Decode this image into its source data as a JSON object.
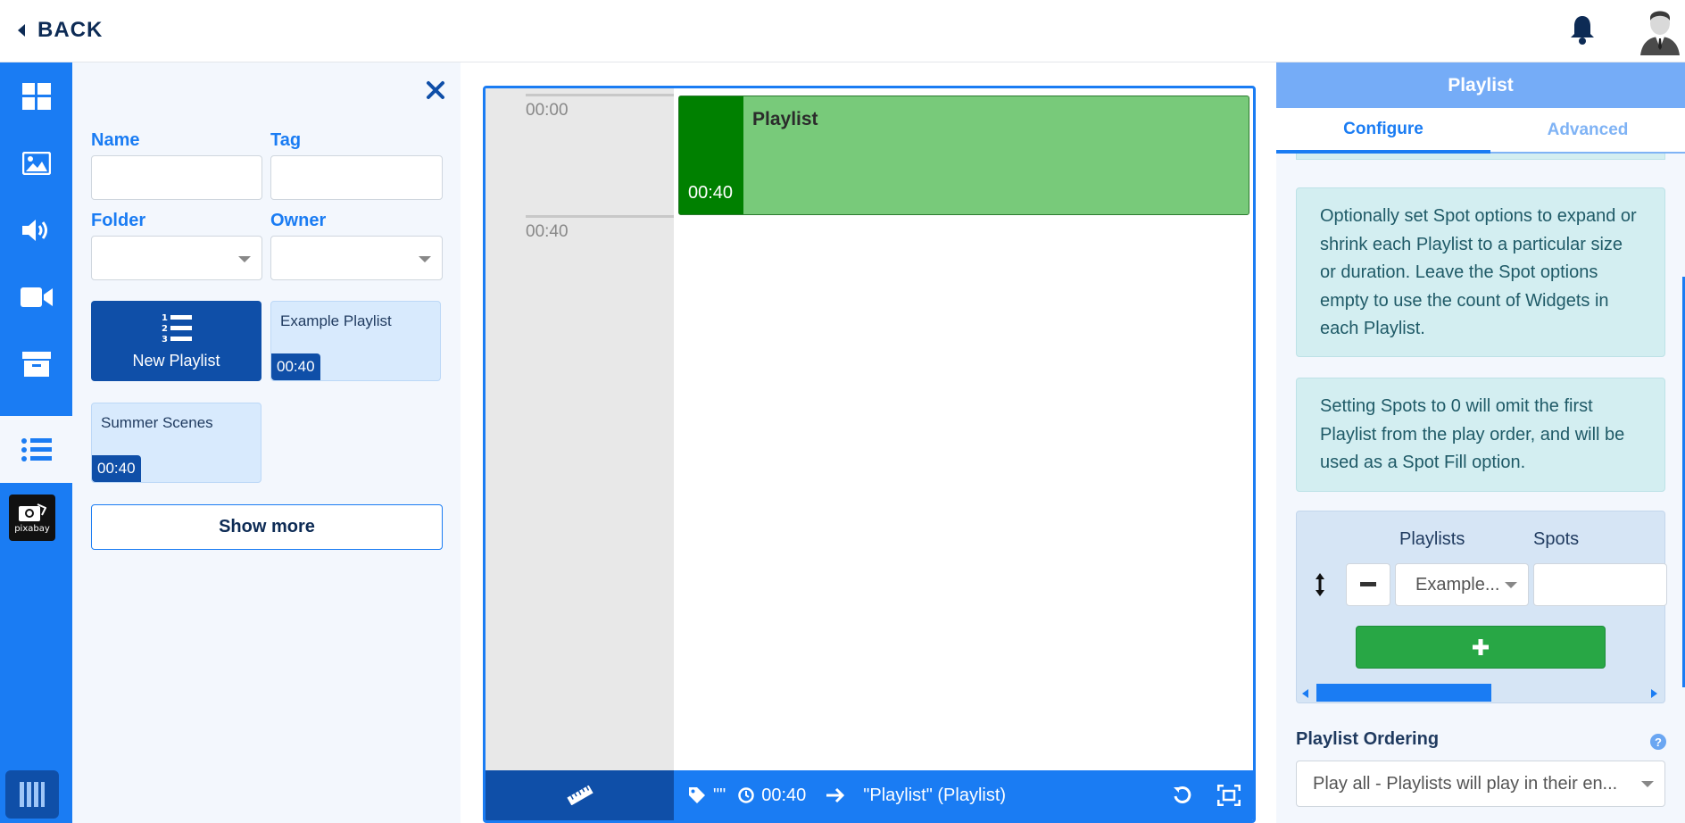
{
  "topbar": {
    "back_label": "BACK"
  },
  "nav": {
    "items": [
      "dashboard-icon",
      "image-icon",
      "audio-icon",
      "video-icon",
      "archive-icon",
      "playlist-icon",
      "pixabay-icon"
    ],
    "pixabay_label": "pixabay",
    "active": "playlist-icon"
  },
  "library": {
    "name_label": "Name",
    "tag_label": "Tag",
    "folder_label": "Folder",
    "owner_label": "Owner",
    "name_value": "",
    "tag_value": "",
    "folder_value": "",
    "owner_value": "",
    "new_playlist_label": "New Playlist",
    "cards": [
      {
        "title": "Example Playlist",
        "duration": "00:40"
      },
      {
        "title": "Summer Scenes",
        "duration": "00:40"
      }
    ],
    "show_more_label": "Show more"
  },
  "timeline": {
    "ticks": [
      "00:00",
      "00:40"
    ],
    "block": {
      "title": "Playlist",
      "duration": "00:40",
      "color": "#78ca7a",
      "side_color": "#008000"
    },
    "footer": {
      "tag_text": "\"\"",
      "duration": "00:40",
      "target": "\"Playlist\" (Playlist)"
    }
  },
  "panel": {
    "header": "Playlist",
    "tabs": {
      "configure": "Configure",
      "advanced": "Advanced",
      "active": "configure"
    },
    "alert1": "Optionally set Spot options to expand or shrink each Playlist to a particular size or duration. Leave the Spot options empty to use the count of Widgets in each Playlist.",
    "alert2": "Setting Spots to 0 will omit the first Playlist from the play order, and will be used as a Spot Fill option.",
    "spots": {
      "col_playlists": "Playlists",
      "col_spots": "Spots",
      "row_playlist": "Example...",
      "row_spots": ""
    },
    "ordering_label": "Playlist Ordering",
    "help": "?",
    "ordering_value": "Play all - Playlists will play in their en..."
  },
  "colors": {
    "primary": "#1a7cf3",
    "dark": "#0f4fa8",
    "success": "#28a745",
    "info_bg": "#d3eef1"
  }
}
